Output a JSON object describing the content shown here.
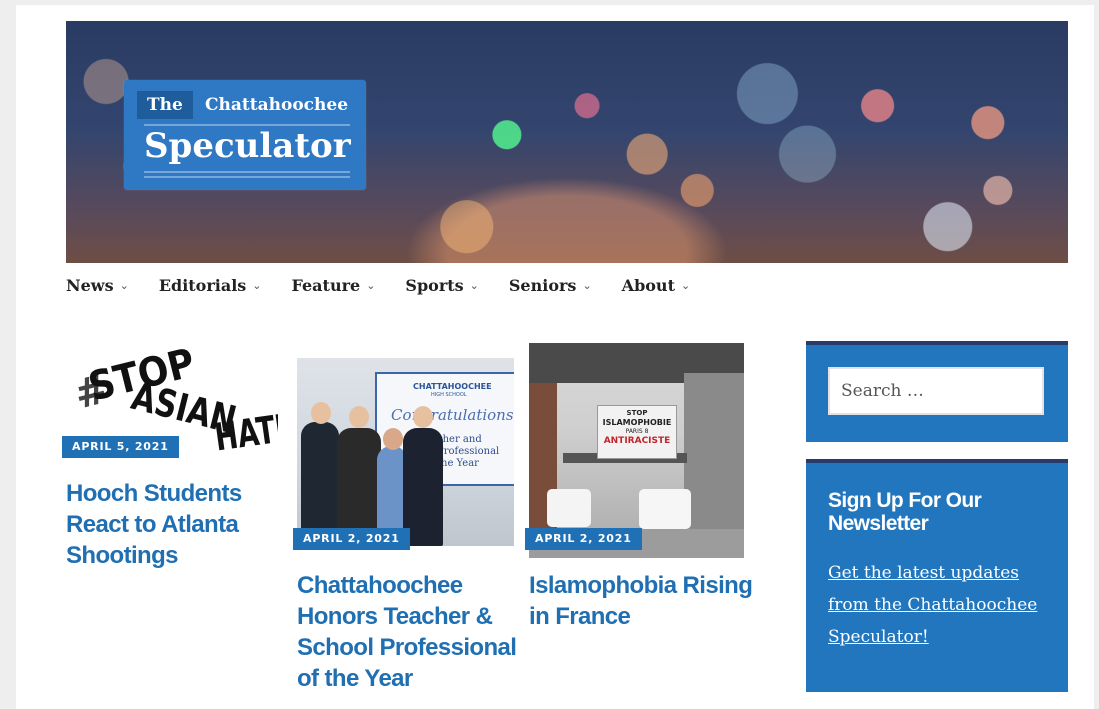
{
  "header": {
    "logo_the": "The",
    "logo_name": "Chattahoochee",
    "logo_title": "Speculator"
  },
  "nav": {
    "items": [
      {
        "label": "News"
      },
      {
        "label": "Editorials"
      },
      {
        "label": "Feature"
      },
      {
        "label": "Sports"
      },
      {
        "label": "Seniors"
      },
      {
        "label": "About"
      }
    ],
    "chevron": "⌄"
  },
  "posts": [
    {
      "date": "APRIL 5, 2021",
      "title": "Hooch Students React to Atlanta Shootings",
      "image_text": {
        "hash": "#",
        "stop": "STOP",
        "asian": "ASIAN",
        "hate": "HATE"
      }
    },
    {
      "date": "APRIL 2, 2021",
      "title": "Chattahoochee Honors Teacher & School Professional of the Year",
      "image_text": {
        "school": "CHATTAHOOCHEE",
        "school_sub": "HIGH SCHOOL",
        "congrats": "Congratulations",
        "line1": "cher and",
        "line2": "Professional",
        "line3": "the Year"
      }
    },
    {
      "date": "APRIL 2, 2021",
      "title": "Islamophobia Rising in France",
      "image_text": {
        "line1": "STOP",
        "line2": "ISLAMOPHOBIE",
        "line3": "PARIS 8",
        "line4": "ANTIRACISTE"
      }
    }
  ],
  "sidebar": {
    "search_placeholder": "Search …",
    "newsletter_title": "Sign Up For Our Newsletter",
    "newsletter_link": "Get the latest updates from the Chattahoochee Speculator!"
  },
  "colors": {
    "accent": "#2176bd",
    "title_blue": "#1f6fb2",
    "widget_border": "#283b6b"
  }
}
